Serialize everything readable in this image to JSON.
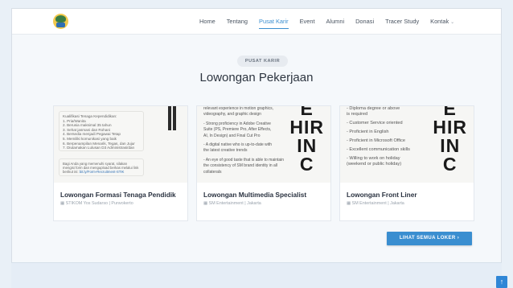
{
  "nav": {
    "items": [
      "Home",
      "Tentang",
      "Pusat Karir",
      "Event",
      "Alumni",
      "Donasi",
      "Tracer Study",
      "Kontak"
    ],
    "active": "Pusat Karir"
  },
  "section": {
    "pill": "PUSAT KARIR",
    "title": "Lowongan Pekerjaan"
  },
  "cards": [
    {
      "title": "Lowongan Formasi Tenaga Pendidik",
      "meta": "STIKOM Yos Sudarso | Purwokerto",
      "poster_lines": [
        "Kualifikasi Tenaga Kependidikan:",
        "1. Pria/Wanita",
        "2. Berusia maksimal 35 tahun",
        "3. Sehat jasmani dan Rohani",
        "4. Bersedia menjadi Pegawai Tetap",
        "5. Memiliki komunikasi yang baik",
        "6. Berpenampilan Menarik, Tegas, dan Jujur",
        "7. Diutamakan Lulusan D3 Administrasi/dan"
      ],
      "poster_note": "Bagi Anda yang memenuhi syarat, silakan mengisi form dan mengupload berkas melalui link berikut ini:",
      "poster_link": "bit.ly/Form-Recruitment-STIK"
    },
    {
      "title": "Lowongan Multimedia Specialist",
      "meta": "SM Entertainment | Jakarta",
      "poster_lines": [
        "relevant experience in motion graphics,",
        "videography, and graphic design",
        "",
        "- Strong proficiency in Adobe Creative",
        "Suite (PS, Premiere Pro, After Effects,",
        "AI, In Design) and Final Cut Pro",
        "",
        "- A digital native who is up-to-date with",
        "the latest creative trends",
        "",
        "- An eye of good taste that is able to maintain",
        "the consistency of SM brand identity in all",
        "collaterals"
      ],
      "poster_big": [
        "E",
        "HIR",
        "IN",
        "C"
      ]
    },
    {
      "title": "Lowongan Front Liner",
      "meta": "SM Entertainment | Jakarta",
      "poster_lines": [
        "- Diploma degree or above",
        "  is required",
        "",
        "- Customer Service oriented",
        "",
        "- Proficient in English",
        "",
        "- Proficient in Microsoft Office",
        "",
        "- Excellent communication skills",
        "",
        "- Willing to work on holiday",
        "  (weekend or public holiday)"
      ],
      "poster_big": [
        "E",
        "HIR",
        "IN",
        "C"
      ]
    }
  ],
  "cta": {
    "label": "LIHAT SEMUA LOKER ›"
  },
  "icons": {
    "location": "pin-icon",
    "building": "building-icon",
    "scroll_top": "arrow-up-icon"
  },
  "colors": {
    "accent": "#3a8ed0"
  }
}
